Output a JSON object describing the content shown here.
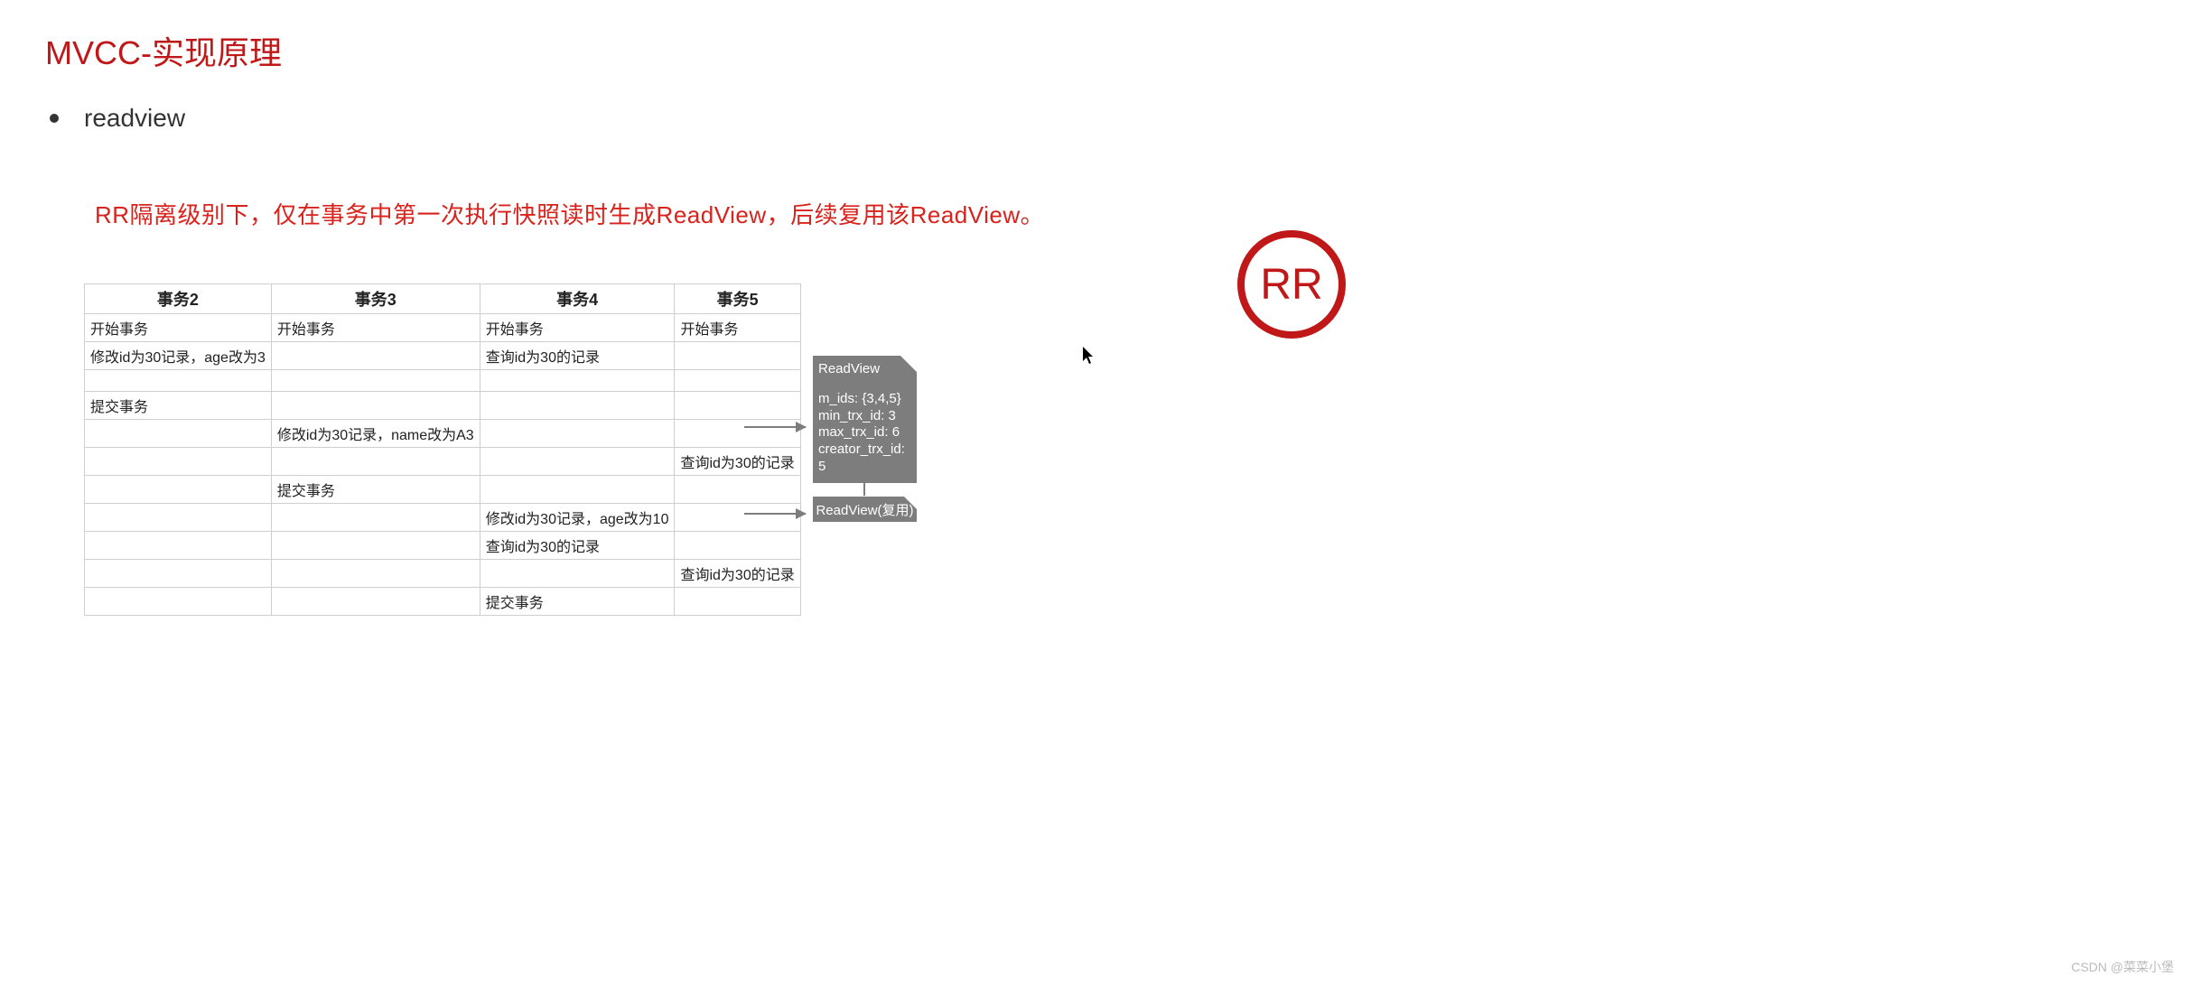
{
  "title": "MVCC-实现原理",
  "bullet": "readview",
  "statement": "RR隔离级别下，仅在事务中第一次执行快照读时生成ReadView，后续复用该ReadView。",
  "table": {
    "headers": [
      "事务2",
      "事务3",
      "事务4",
      "事务5"
    ],
    "rows": [
      [
        "开始事务",
        "开始事务",
        "开始事务",
        "开始事务"
      ],
      [
        "修改id为30记录，age改为3",
        "",
        "查询id为30的记录",
        ""
      ],
      [
        "",
        "",
        "",
        ""
      ],
      [
        "提交事务",
        "",
        "",
        ""
      ],
      [
        "",
        "修改id为30记录，name改为A3",
        "",
        ""
      ],
      [
        "",
        "",
        "",
        "查询id为30的记录"
      ],
      [
        "",
        "提交事务",
        "",
        ""
      ],
      [
        "",
        "",
        "修改id为30记录，age改为10",
        ""
      ],
      [
        "",
        "",
        "查询id为30的记录",
        ""
      ],
      [
        "",
        "",
        "",
        "查询id为30的记录"
      ],
      [
        "",
        "",
        "提交事务",
        ""
      ]
    ]
  },
  "readview": {
    "title": "ReadView",
    "m_ids": "m_ids: {3,4,5}",
    "min_trx_id": "min_trx_id: 3",
    "max_trx_id": "max_trx_id: 6",
    "creator_trx_id": "creator_trx_id: 5"
  },
  "reuse_label": "ReadView(复用)",
  "badge": "RR",
  "watermark": "CSDN @菜菜小堡"
}
